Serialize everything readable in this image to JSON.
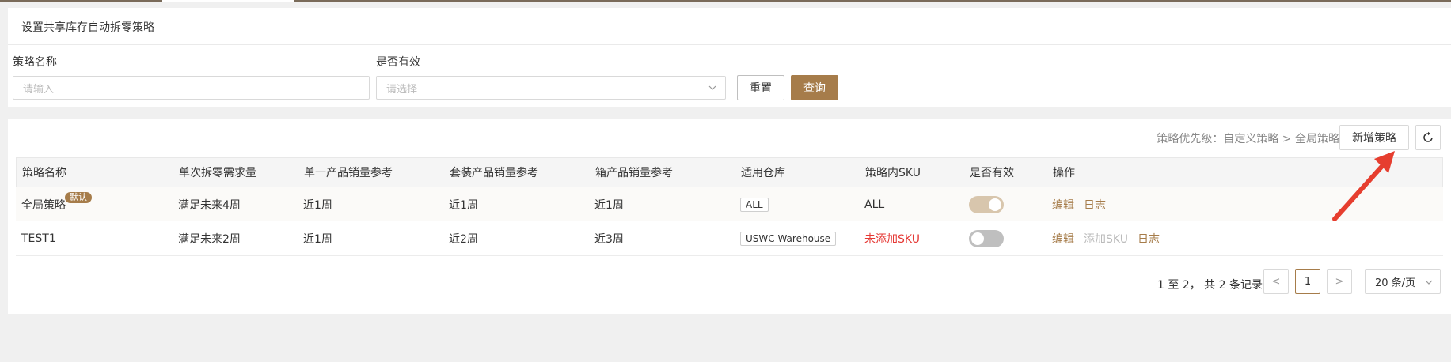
{
  "colors": {
    "accent": "#a67c4a",
    "danger": "#e53935",
    "toggle_on": "#d8c6ad",
    "toggle_off": "#bfbfbf",
    "annotation_arrow": "#e63e2f"
  },
  "filter": {
    "title": "设置共享库存自动拆零策略",
    "name_label": "策略名称",
    "name_placeholder": "请输入",
    "valid_label": "是否有效",
    "valid_placeholder": "请选择",
    "reset_label": "重置",
    "query_label": "查询"
  },
  "toolbar": {
    "priority_note": "策略优先级：自定义策略 > 全局策略",
    "add_label": "新增策略",
    "refresh_icon": "refresh-icon"
  },
  "table": {
    "columns": [
      "策略名称",
      "单次拆零需求量",
      "单一产品销量参考",
      "套装产品销量参考",
      "箱产品销量参考",
      "适用仓库",
      "策略内SKU",
      "是否有效",
      "操作"
    ],
    "rows": [
      {
        "name": "全局策略",
        "badge": "默认",
        "demand": "满足未来4周",
        "single": "近1周",
        "set": "近1周",
        "box": "近1周",
        "warehouse": "ALL",
        "sku": "ALL",
        "enabled": true,
        "actions": [
          "编辑",
          "日志"
        ]
      },
      {
        "name": "TEST1",
        "badge": "",
        "demand": "满足未来2周",
        "single": "近1周",
        "set": "近2周",
        "box": "近3周",
        "warehouse": "USWC Warehouse",
        "sku": "未添加SKU",
        "enabled": false,
        "actions": [
          "编辑",
          "添加SKU",
          "日志"
        ]
      }
    ]
  },
  "pagination": {
    "info": "1 至 2， 共 2 条记录",
    "prev": "<",
    "current": "1",
    "next": ">",
    "page_size": "20 条/页"
  }
}
